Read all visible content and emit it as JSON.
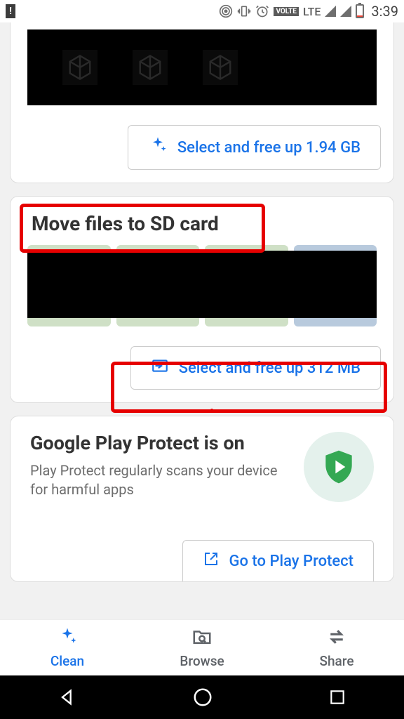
{
  "status": {
    "lte": "LTE",
    "volte": "VOLTE",
    "time": "3:39"
  },
  "card_freeup": {
    "button_label": "Select and free up 1.94 GB"
  },
  "card_move": {
    "title": "Move files to SD card",
    "button_label": "Select and free up 312 MB"
  },
  "card_protect": {
    "title": "Google Play Protect is on",
    "subtitle": "Play Protect regularly scans your device for harmful apps",
    "button_label": "Go to Play Protect"
  },
  "nav": {
    "clean": "Clean",
    "browse": "Browse",
    "share": "Share"
  }
}
